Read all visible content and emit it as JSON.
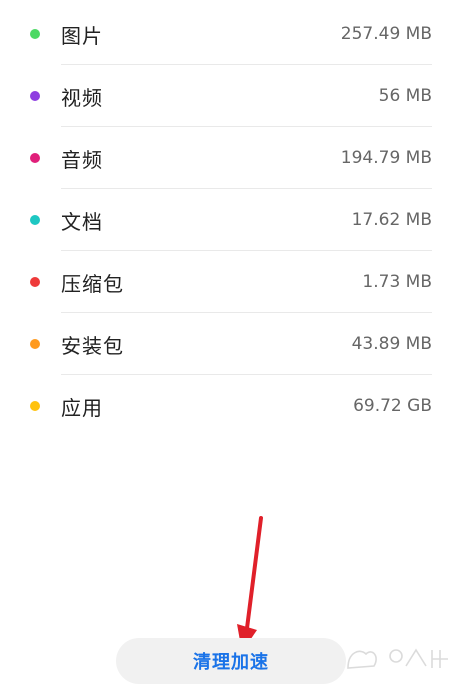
{
  "storage": {
    "items": [
      {
        "label": "图片",
        "size": "257.49 MB",
        "color": "#4cd964"
      },
      {
        "label": "视频",
        "size": "56 MB",
        "color": "#8e3ee0"
      },
      {
        "label": "音频",
        "size": "194.79 MB",
        "color": "#e01f7a"
      },
      {
        "label": "文档",
        "size": "17.62 MB",
        "color": "#1dc7c2"
      },
      {
        "label": "压缩包",
        "size": "1.73 MB",
        "color": "#ee3a3a"
      },
      {
        "label": "安装包",
        "size": "43.89 MB",
        "color": "#ff9a1f"
      },
      {
        "label": "应用",
        "size": "69.72 GB",
        "color": "#ffc20e"
      }
    ]
  },
  "actions": {
    "clean_label": "清理加速"
  },
  "annotation": {
    "arrow_color": "#e0202a"
  }
}
